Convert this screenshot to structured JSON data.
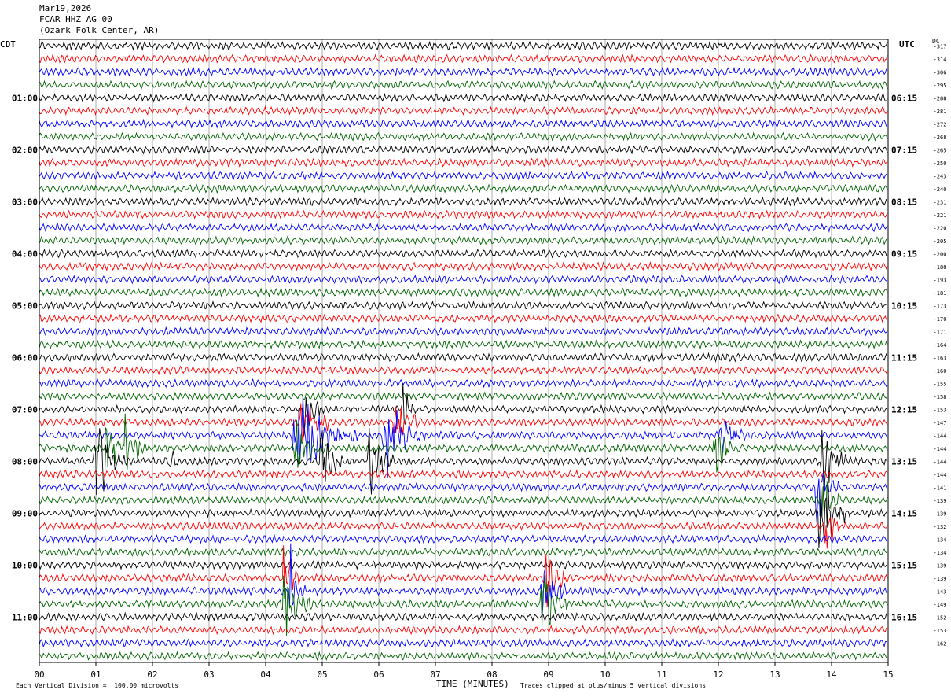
{
  "header": {
    "date": "Mar19,2026",
    "station": "FCAR HHZ AG 00",
    "location": "(Ozark Folk Center, AR)"
  },
  "left_axis_label": "CDT",
  "right_axis_label": "UTC",
  "dc_label": "DC",
  "footer": {
    "scale_note": "Each Vertical Division =  100.00 microvolts",
    "x_axis_label": "TIME (MINUTES)",
    "clip_note": "Traces clipped at plus/minus 5 vertical divisions"
  },
  "chart_data": {
    "type": "line",
    "x_ticks": [
      "00",
      "01",
      "02",
      "03",
      "04",
      "05",
      "06",
      "07",
      "08",
      "09",
      "10",
      "11",
      "12",
      "13",
      "14",
      "15"
    ],
    "xlim": [
      0,
      15
    ],
    "trace_colors": [
      "#000000",
      "#ff0000",
      "#0000ff",
      "#006400"
    ],
    "cdt_labels": [
      {
        "row": 4,
        "text": "01:00"
      },
      {
        "row": 8,
        "text": "02:00"
      },
      {
        "row": 12,
        "text": "03:00"
      },
      {
        "row": 16,
        "text": "04:00"
      },
      {
        "row": 20,
        "text": "05:00"
      },
      {
        "row": 24,
        "text": "06:00"
      },
      {
        "row": 28,
        "text": "07:00"
      },
      {
        "row": 32,
        "text": "08:00"
      },
      {
        "row": 36,
        "text": "09:00"
      },
      {
        "row": 40,
        "text": "10:00"
      },
      {
        "row": 44,
        "text": "11:00"
      }
    ],
    "utc_labels": [
      {
        "row": 4,
        "text": "06:15"
      },
      {
        "row": 8,
        "text": "07:15"
      },
      {
        "row": 12,
        "text": "08:15"
      },
      {
        "row": 16,
        "text": "09:15"
      },
      {
        "row": 20,
        "text": "10:15"
      },
      {
        "row": 24,
        "text": "11:15"
      },
      {
        "row": 28,
        "text": "12:15"
      },
      {
        "row": 32,
        "text": "13:15"
      },
      {
        "row": 36,
        "text": "14:15"
      },
      {
        "row": 40,
        "text": "15:15"
      },
      {
        "row": 44,
        "text": "16:15"
      }
    ],
    "dc_values": [
      "-317",
      "-314",
      "-306",
      "-295",
      "-288",
      "-281",
      "-272",
      "-268",
      "-265",
      "-250",
      "-243",
      "-240",
      "-231",
      "-221",
      "-220",
      "-205",
      "-200",
      "-188",
      "-193",
      "-181",
      "-173",
      "-170",
      "-171",
      "-164",
      "-163",
      "-160",
      "-155",
      "-158",
      "-153",
      "-147",
      "-144",
      "-144",
      "-144",
      "-144",
      "-141",
      "-139",
      "-139",
      "-132",
      "-134",
      "-134",
      "-139",
      "-139",
      "-143",
      "-149",
      "-152",
      "-153",
      "-162"
    ],
    "events": [
      {
        "row": 28,
        "minute": 4.65,
        "duration": 0.4,
        "amp": 3.5
      },
      {
        "row": 28,
        "minute": 6.4,
        "duration": 0.25,
        "amp": 3.2
      },
      {
        "row": 29,
        "minute": 4.6,
        "duration": 0.6,
        "amp": 4
      },
      {
        "row": 29,
        "minute": 6.25,
        "duration": 0.5,
        "amp": 3.5
      },
      {
        "row": 30,
        "minute": 4.45,
        "duration": 1.2,
        "amp": 5
      },
      {
        "row": 30,
        "minute": 6.05,
        "duration": 0.8,
        "amp": 4
      },
      {
        "row": 30,
        "minute": 12.0,
        "duration": 0.6,
        "amp": 2.2
      },
      {
        "row": 31,
        "minute": 1.15,
        "duration": 0.45,
        "amp": 2.8
      },
      {
        "row": 31,
        "minute": 1.45,
        "duration": 0.45,
        "amp": 3
      },
      {
        "row": 31,
        "minute": 4.5,
        "duration": 0.6,
        "amp": 2.5
      },
      {
        "row": 31,
        "minute": 11.9,
        "duration": 0.5,
        "amp": 2.5
      },
      {
        "row": 32,
        "minute": 0.95,
        "duration": 0.6,
        "amp": 5
      },
      {
        "row": 32,
        "minute": 2.3,
        "duration": 0.3,
        "amp": 1.5
      },
      {
        "row": 32,
        "minute": 4.95,
        "duration": 0.4,
        "amp": 5
      },
      {
        "row": 32,
        "minute": 5.8,
        "duration": 0.45,
        "amp": 5
      },
      {
        "row": 32,
        "minute": 13.8,
        "duration": 0.45,
        "amp": 5
      },
      {
        "row": 34,
        "minute": 13.7,
        "duration": 0.5,
        "amp": 3.5
      },
      {
        "row": 35,
        "minute": 13.8,
        "duration": 0.4,
        "amp": 4
      },
      {
        "row": 36,
        "minute": 13.75,
        "duration": 0.6,
        "amp": 5
      },
      {
        "row": 37,
        "minute": 13.85,
        "duration": 0.4,
        "amp": 3
      },
      {
        "row": 41,
        "minute": 4.3,
        "duration": 0.3,
        "amp": 5
      },
      {
        "row": 41,
        "minute": 8.9,
        "duration": 0.5,
        "amp": 3.5
      },
      {
        "row": 42,
        "minute": 4.4,
        "duration": 0.3,
        "amp": 5
      },
      {
        "row": 42,
        "minute": 8.85,
        "duration": 0.5,
        "amp": 5
      },
      {
        "row": 43,
        "minute": 4.25,
        "duration": 0.6,
        "amp": 5
      },
      {
        "row": 43,
        "minute": 8.85,
        "duration": 0.5,
        "amp": 5
      }
    ]
  }
}
